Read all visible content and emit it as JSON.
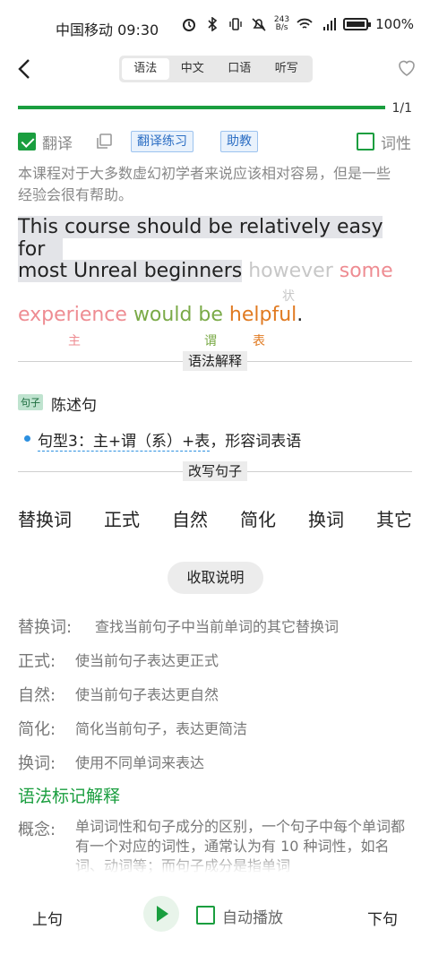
{
  "status_bar": {
    "carrier_time": "中国移动 09:30",
    "net_speed_value": "243",
    "net_speed_unit": "B/s",
    "battery": "100%",
    "icons": [
      "alarm-icon",
      "bluetooth-icon",
      "vibrate-icon",
      "mute-icon",
      "wifi-icon",
      "signal-5g-icon",
      "battery-icon"
    ]
  },
  "header": {
    "tabs": [
      {
        "label": "语法",
        "active": true
      },
      {
        "label": "中文",
        "active": false
      },
      {
        "label": "口语",
        "active": false
      },
      {
        "label": "听写",
        "active": false
      }
    ]
  },
  "progress": {
    "text": "1/1",
    "fraction": 1.0,
    "color": "#1a9e3f"
  },
  "options": {
    "translate_label": "翻译",
    "translate_checked": true,
    "practice_chip": "翻译练习",
    "tutor_chip": "助教",
    "pos_label": "词性",
    "pos_checked": false
  },
  "translation": "本课程对于大多数虚幻初学者来说应该相对容易，但是一些经验会很有帮助。",
  "sentence": {
    "line1": "This course should be relatively easy for",
    "line2_main": "most Unreal beginners",
    "line2_however": "however",
    "line2_some": "some",
    "line3_experience": "experience",
    "line3_would": "would be",
    "line3_helpful": "helpful",
    "line3_period": ".",
    "tag_adverbial": "状",
    "tag_subject": "主",
    "tag_predicate": "谓",
    "tag_complement": "表"
  },
  "grammar": {
    "section_title": "语法解释",
    "badge": "句子",
    "sentence_type": "陈述句",
    "pattern_underlined": "句型3：主+谓（系）+表",
    "pattern_rest": "，形容词表语"
  },
  "rewrite": {
    "section_title": "改写句子",
    "tabs": [
      "替换词",
      "正式",
      "自然",
      "简化",
      "换词",
      "其它"
    ],
    "collapse_button": "收取说明",
    "explanations": [
      {
        "key": "替换词:",
        "value": "查找当前句子中当前单词的其它替换词"
      },
      {
        "key": "正式:",
        "value": "使当前句子表达更正式"
      },
      {
        "key": "自然:",
        "value": "使当前句子表达更自然"
      },
      {
        "key": "简化:",
        "value": "简化当前句子，表达更简洁"
      },
      {
        "key": "换词:",
        "value": "使用不同单词来表达"
      }
    ]
  },
  "marks": {
    "title": "语法标记解释",
    "concept_key": "概念:",
    "concept_value": "单词词性和句子成分的区别，一个句子中每个单词都有一个对应的词性，通常认为有 10 种词性，如名词、动词等；而句子成分是指单词"
  },
  "bottom_bar": {
    "prev": "上句",
    "next": "下句",
    "auto_play": "自动播放",
    "auto_play_checked": false
  }
}
